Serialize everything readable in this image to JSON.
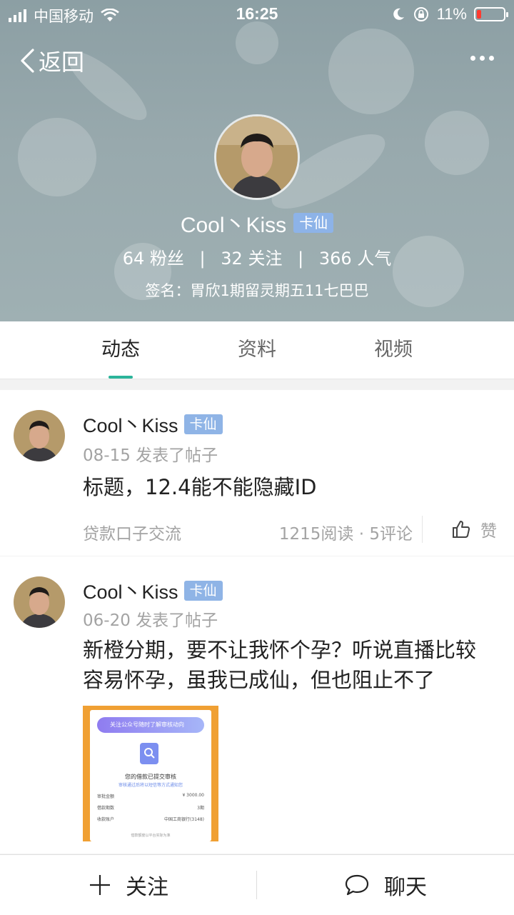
{
  "status_bar": {
    "carrier": "中国移动",
    "time": "16:25",
    "battery": "11%",
    "battery_level": 0.11
  },
  "nav": {
    "back_label": "返回",
    "more_icon": "more-dots-icon"
  },
  "profile": {
    "name": "Cool丶Kiss",
    "badge": "卡仙",
    "fans_count": "64",
    "fans_label": "粉丝",
    "follow_count": "32",
    "follow_label": "关注",
    "popularity_count": "366",
    "popularity_label": "人气",
    "stats_separator": "|",
    "signature": "签名：胃欣1期留灵期五11七巴巴"
  },
  "tabs": [
    {
      "label": "动态",
      "active": true
    },
    {
      "label": "资料",
      "active": false
    },
    {
      "label": "视频",
      "active": false
    }
  ],
  "posts": [
    {
      "author": "Cool丶Kiss",
      "badge": "卡仙",
      "meta": "08-15 发表了帖子",
      "title": "标题，12.4能不能隐藏ID",
      "forum": "贷款口子交流",
      "counts": "1215阅读 · 5评论",
      "like_label": "赞"
    },
    {
      "author": "Cool丶Kiss",
      "badge": "卡仙",
      "meta": "06-20 发表了帖子",
      "title": "新橙分期，要不让我怀个孕？听说直播比较容易怀孕，虽我已成仙，但也阻止不了",
      "image": {
        "banner": "关注公众号随时了解审核动向",
        "status": "您的借款已提交审核",
        "subtitle": "审核通过后将以短信等方式通知您",
        "rows": [
          {
            "label": "审批金额",
            "value": "¥ 3000.00"
          },
          {
            "label": "借款期数",
            "value": "3期"
          },
          {
            "label": "收款账户",
            "value": "中国工商银行(3148)"
          }
        ],
        "footer": "借款额度以平台实际为准"
      }
    }
  ],
  "bottom_bar": {
    "follow_label": "关注",
    "chat_label": "聊天"
  },
  "colors": {
    "accent": "#2bb49a",
    "badge": "#8fb4e6",
    "header_bg": "#98a9ad"
  }
}
